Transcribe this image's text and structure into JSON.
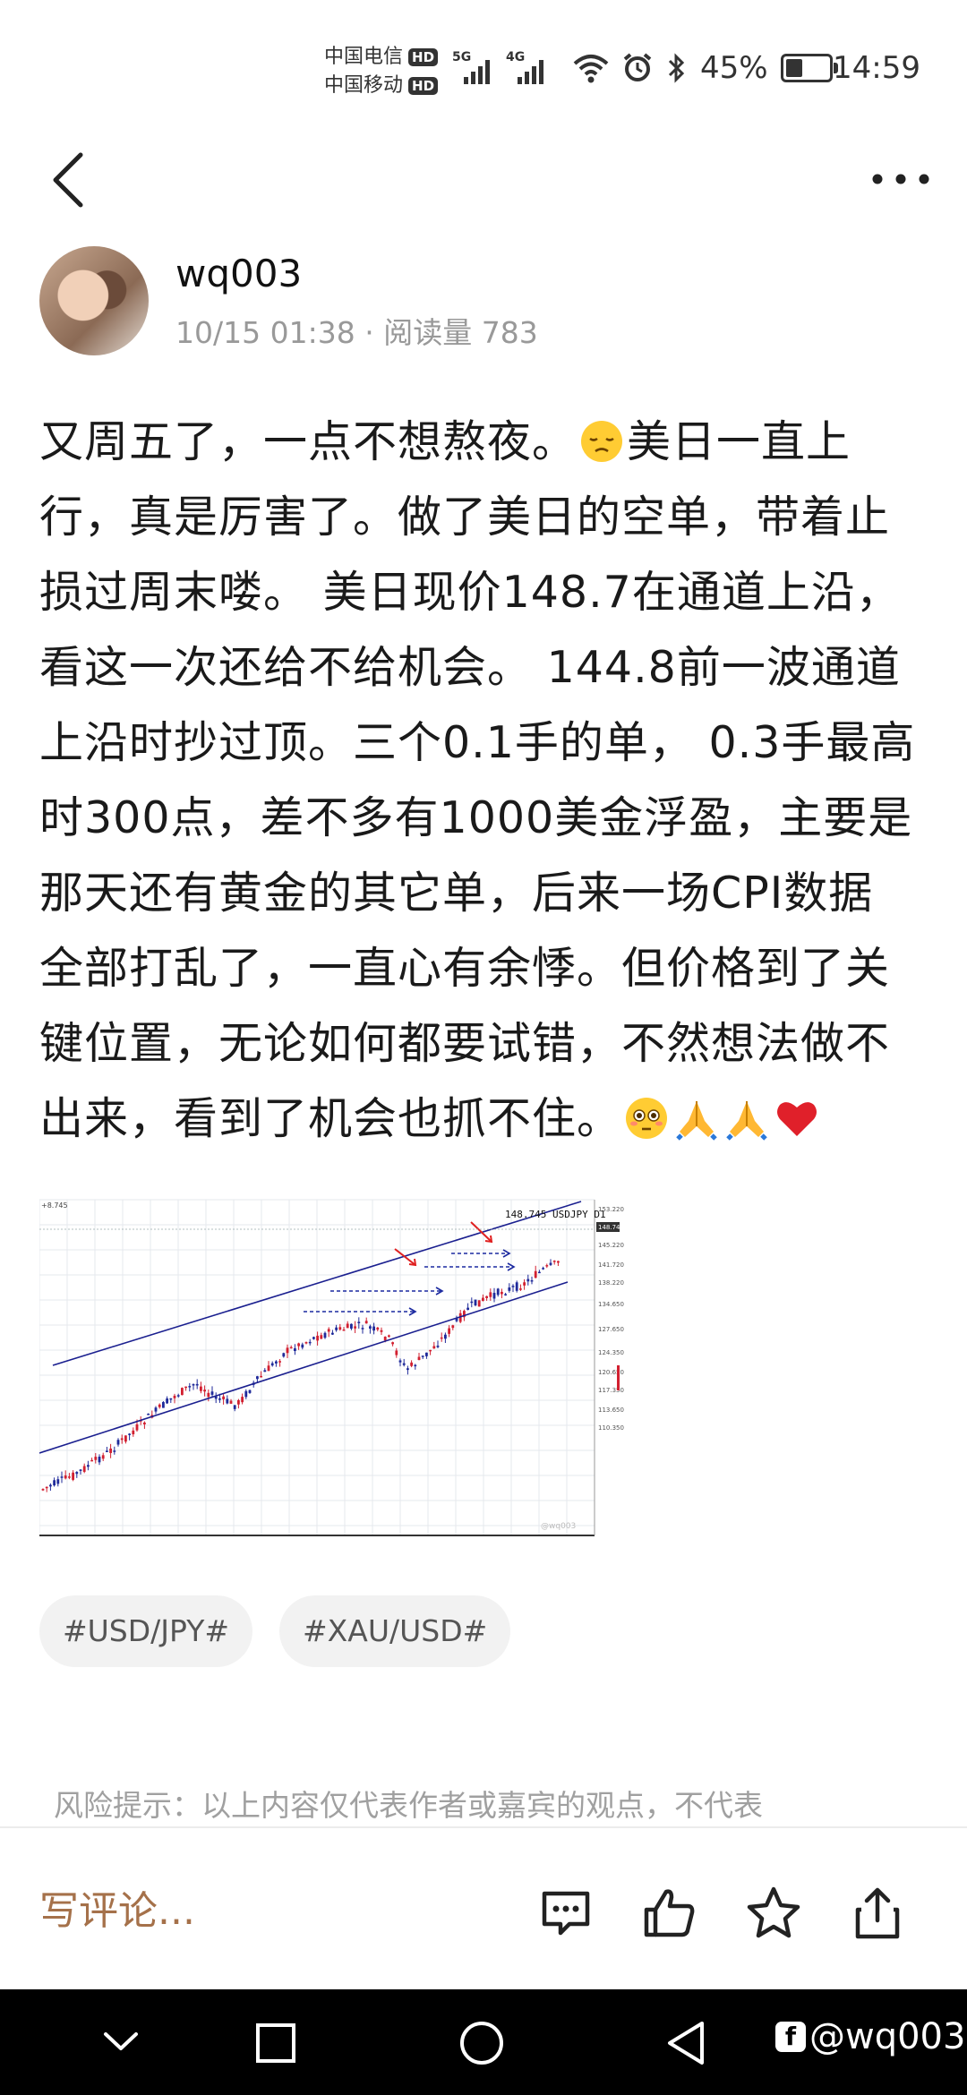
{
  "status_bar": {
    "carrier1": "中国电信",
    "carrier2": "中国移动",
    "hd": "HD",
    "net1": "5G",
    "net2": "4G",
    "battery": "45%",
    "time": "14:59"
  },
  "post": {
    "author": "wq003",
    "date": "10/15 01:38",
    "separator": "·",
    "reads_label": "阅读量",
    "reads": "783",
    "lines": [
      [
        "又周五了，一点不想熬夜。",
        "emoji:pensive",
        "美日一直上"
      ],
      [
        "行，真是厉害了。做了美日的空单，带着止"
      ],
      [
        "损过周末喽。 美日现价148.7在通道上沿，"
      ],
      [
        "看这一次还给不给机会。 144.8前一波通道"
      ],
      [
        "上沿时抄过顶。三个0.1手的单，  0.3手最高"
      ],
      [
        "时300点，差不多有1000美金浮盈，主要是"
      ],
      [
        "那天还有黄金的其它单，后来一场CPI数据"
      ],
      [
        "全部打乱了，一直心有余悸。但价格到了关"
      ],
      [
        "键位置，无论如何都要试错，不然想法做不"
      ],
      [
        "出来，看到了机会也抓不住。",
        "emoji:flushed",
        "emoji:pray",
        "emoji:pray",
        "emoji:heart"
      ]
    ],
    "tags": [
      "#USD/JPY#",
      "#XAU/USD#"
    ],
    "risk_notice": "风险提示：以上内容仅代表作者或嘉宾的观点，不代表"
  },
  "chart_data": {
    "type": "candlestick",
    "title": "148.745 USDJPY D1",
    "top_left_label": "+8.745",
    "price_label": "148.745",
    "y_ticks": [
      "153.220",
      "148.745",
      "145.220",
      "141.720",
      "138.220",
      "134.650",
      "127.650",
      "124.350",
      "120.650",
      "117.350",
      "113.650",
      "110.350"
    ],
    "watermark": "@wq003",
    "colors": {
      "up": "#1f2a9a",
      "down": "#d22030",
      "channel": "#1a1f8f",
      "arrow": "#e02020"
    }
  },
  "bottom_bar": {
    "comment_placeholder": "写评论..."
  },
  "nav": {
    "watermark": "@wq003"
  }
}
